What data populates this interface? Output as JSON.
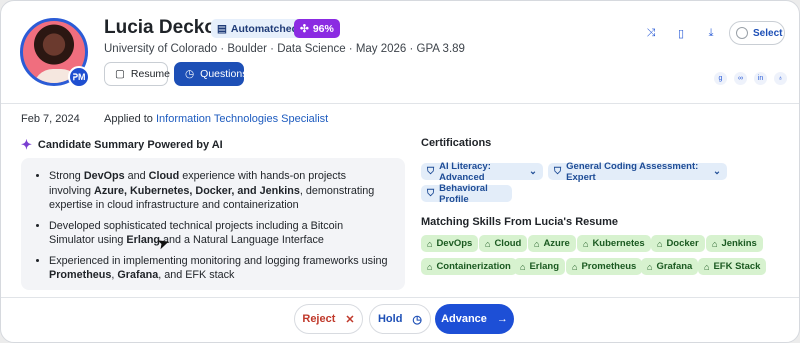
{
  "candidate": {
    "name": "Lucia Deckow",
    "avatar_badge": "ᕈM",
    "subline": "University of Colorado · Boulder · Data Science · May 2026 · GPA 3.89",
    "badges": {
      "automatched": "Automatched",
      "match_percent": "96%"
    }
  },
  "actions_top": {
    "resume_label": "Resume",
    "questions_label": "Questions",
    "select_label": "Select",
    "icons": [
      "shuffle-icon",
      "document-icon",
      "download-icon"
    ],
    "social": [
      "github-icon",
      "link-icon",
      "linkedin-icon",
      "bulb-icon"
    ]
  },
  "application": {
    "date": "Feb 7, 2024",
    "applied_prefix": "Applied to ",
    "position": "Information Technologies Specialist"
  },
  "summary": {
    "title": "Candidate Summary Powered by AI",
    "bullets": [
      [
        {
          "t": "Strong "
        },
        {
          "t": "DevOps",
          "b": true
        },
        {
          "t": " and "
        },
        {
          "t": "Cloud",
          "b": true
        },
        {
          "t": " experience with hands-on projects involving "
        },
        {
          "t": "Azure, Kubernetes, Docker, and Jenkins",
          "b": true
        },
        {
          "t": ", demonstrating expertise in cloud infrastructure and containerization"
        }
      ],
      [
        {
          "t": "Developed sophisticated technical projects including a Bitcoin Simulator using "
        },
        {
          "t": "Erlang",
          "b": true
        },
        {
          "t": " and a Natural Language Interface"
        }
      ],
      [
        {
          "t": "Experienced in implementing monitoring and logging frameworks using "
        },
        {
          "t": "Prometheus",
          "b": true
        },
        {
          "t": ", "
        },
        {
          "t": "Grafana",
          "b": true
        },
        {
          "t": ", and EFK stack"
        }
      ]
    ]
  },
  "certifications": {
    "title": "Certifications",
    "items": [
      "AI Literacy: Advanced",
      "General Coding Assessment: Expert",
      "Behavioral Profile"
    ]
  },
  "skills": {
    "title": "Matching Skills From Lucia's Resume",
    "items": [
      "DevOps",
      "Cloud",
      "Azure",
      "Kubernetes",
      "Docker",
      "Jenkins",
      "Containerization",
      "Erlang",
      "Prometheus",
      "Grafana",
      "EFK Stack"
    ]
  },
  "decision": {
    "reject": "Reject",
    "hold": "Hold",
    "advance": "Advance"
  },
  "colors": {
    "primary": "#1d4fd6",
    "match_badge": "#8b2be2",
    "skill_bg": "#d7f2cf",
    "cert_bg": "#e3edf9"
  }
}
